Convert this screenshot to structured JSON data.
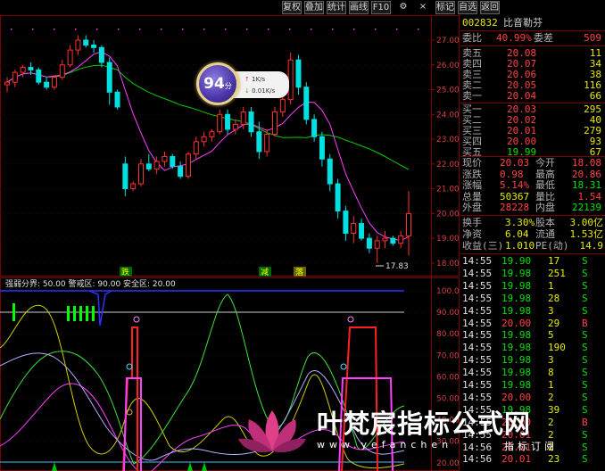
{
  "toolbar": {
    "buttons": [
      "复权",
      "叠加",
      "统计",
      "画线",
      "F10",
      "标记",
      "自选",
      "返回"
    ],
    "gear_icon": "gear-icon",
    "close_icon": "close-icon"
  },
  "stock": {
    "code": "002832",
    "name": "比音勒芬"
  },
  "order_book": {
    "weibi_label": "委比",
    "weibi_value": "40.99%",
    "weicha_label": "委差",
    "weicha_value": "509",
    "asks": [
      {
        "label": "卖五",
        "price": "20.08",
        "vol": "11"
      },
      {
        "label": "卖四",
        "price": "20.07",
        "vol": "34"
      },
      {
        "label": "卖三",
        "price": "20.06",
        "vol": "38"
      },
      {
        "label": "卖二",
        "price": "20.05",
        "vol": "116"
      },
      {
        "label": "卖一",
        "price": "20.04",
        "vol": "66"
      }
    ],
    "bids": [
      {
        "label": "买一",
        "price": "20.03",
        "vol": "295"
      },
      {
        "label": "买二",
        "price": "20.02",
        "vol": "40"
      },
      {
        "label": "买三",
        "price": "20.01",
        "vol": "279"
      },
      {
        "label": "买四",
        "price": "20.00",
        "vol": "93"
      },
      {
        "label": "买五",
        "price": "19.99",
        "vol": "67"
      }
    ]
  },
  "quote": [
    {
      "l1": "现价",
      "v1": "20.03",
      "l2": "今开",
      "v2": "18.08"
    },
    {
      "l1": "涨跌",
      "v1": "0.98",
      "l2": "最高",
      "v2": "20.86"
    },
    {
      "l1": "涨幅",
      "v1": "5.14%",
      "l2": "最低",
      "v2": "18.31"
    },
    {
      "l1": "总量",
      "v1": "50367",
      "l2": "量比",
      "v2": "1.54"
    },
    {
      "l1": "外盘",
      "v1": "28228",
      "l2": "内盘",
      "v2": "22139"
    }
  ],
  "finance": [
    {
      "l1": "换手",
      "v1": "3.30%",
      "l2": "股本",
      "v2": "3.00亿"
    },
    {
      "l1": "净资",
      "v1": "6.04",
      "l2": "流通",
      "v2": "1.53亿"
    },
    {
      "l1": "收益(三)",
      "v1": "1.010",
      "l2": "PE(动)",
      "v2": "14.9"
    }
  ],
  "ticks": [
    {
      "time": "14:55",
      "price": "19.90",
      "vol": "17",
      "side": "S"
    },
    {
      "time": "14:55",
      "price": "19.98",
      "vol": "251",
      "side": "S"
    },
    {
      "time": "14:55",
      "price": "19.98",
      "vol": "1",
      "side": "S"
    },
    {
      "time": "14:55",
      "price": "19.98",
      "vol": "28",
      "side": "S"
    },
    {
      "time": "14:55",
      "price": "19.98",
      "vol": "3",
      "side": "S"
    },
    {
      "time": "14:55",
      "price": "20.00",
      "vol": "29",
      "side": "B"
    },
    {
      "time": "14:55",
      "price": "19.98",
      "vol": "5",
      "side": "S"
    },
    {
      "time": "14:55",
      "price": "19.98",
      "vol": "190",
      "side": "S"
    },
    {
      "time": "14:55",
      "price": "19.98",
      "vol": "3",
      "side": "S"
    },
    {
      "time": "14:55",
      "price": "19.98",
      "vol": "8",
      "side": "S"
    },
    {
      "time": "14:55",
      "price": "19.98",
      "vol": "1",
      "side": "S"
    },
    {
      "time": "14:55",
      "price": "20.00",
      "vol": "2",
      "side": "S"
    },
    {
      "time": "14:55",
      "price": "19.98",
      "vol": "39",
      "side": "S"
    },
    {
      "time": "14:55",
      "price": "20.00",
      "vol": "2",
      "side": "B"
    },
    {
      "time": "14:55",
      "price": "20.01",
      "vol": "2",
      "side": "S"
    },
    {
      "time": "14:56",
      "price": "20.01",
      "vol": "2",
      "side": "S"
    },
    {
      "time": "14:56",
      "price": "20.01",
      "vol": "23",
      "side": "S"
    }
  ],
  "main_chart": {
    "y_ticks": [
      "27.00",
      "26.00",
      "25.00",
      "24.00",
      "23.00",
      "22.00",
      "21.00",
      "20.00",
      "19.00",
      "18.00"
    ],
    "low_marker": "17.83",
    "signals": [
      "跌",
      "减",
      "落"
    ]
  },
  "indicator": {
    "header": "强弱分界: 50.00  警戒区: 90.00  安全区: 20.00",
    "y_ticks": [
      "100.0",
      "90.00",
      "80.00",
      "70.00",
      "60.00",
      "50.00",
      "40.00",
      "30.00",
      "20.00"
    ]
  },
  "score_badge": {
    "score": "94",
    "unit": "分",
    "up_speed": "1K/s",
    "down_speed": "0.01K/s"
  },
  "watermark": {
    "title": "叶梵宸指标公式网",
    "url": "www.yefanchen",
    "sub": "指标订阅"
  },
  "colors": {
    "up": "#ff3030",
    "down": "#00e0e0",
    "ma_fast": "#ff40ff",
    "ma_slow": "#00d000"
  },
  "chart_data": {
    "type": "candlestick",
    "ylim": [
      17.6,
      27.9
    ],
    "ohlc": [
      [
        25.2,
        25.5,
        24.9,
        25.3
      ],
      [
        25.3,
        25.8,
        25.1,
        25.7
      ],
      [
        25.7,
        26.0,
        25.5,
        25.9
      ],
      [
        25.9,
        26.1,
        25.6,
        25.8
      ],
      [
        25.8,
        25.9,
        25.2,
        25.3
      ],
      [
        25.3,
        25.5,
        25.0,
        25.1
      ],
      [
        25.1,
        25.6,
        25.0,
        25.5
      ],
      [
        25.5,
        26.2,
        25.4,
        26.0
      ],
      [
        26.0,
        26.8,
        25.9,
        26.6
      ],
      [
        26.6,
        27.2,
        26.4,
        27.0
      ],
      [
        27.0,
        27.2,
        26.7,
        26.8
      ],
      [
        26.8,
        27.0,
        26.5,
        26.7
      ],
      [
        26.7,
        26.8,
        25.9,
        26.1
      ],
      [
        26.1,
        26.3,
        24.4,
        24.9
      ],
      [
        24.9,
        25.0,
        24.2,
        24.3
      ],
      [
        22.0,
        22.3,
        20.7,
        21.0
      ],
      [
        21.0,
        21.3,
        20.9,
        21.2
      ],
      [
        21.2,
        22.2,
        21.1,
        22.0
      ],
      [
        22.0,
        22.4,
        21.7,
        21.8
      ],
      [
        21.8,
        22.3,
        21.6,
        22.1
      ],
      [
        22.1,
        22.5,
        21.9,
        22.3
      ],
      [
        22.3,
        22.4,
        21.8,
        21.9
      ],
      [
        21.9,
        22.1,
        21.4,
        21.5
      ],
      [
        21.5,
        22.5,
        21.4,
        22.4
      ],
      [
        22.4,
        23.1,
        22.2,
        22.9
      ],
      [
        22.9,
        23.3,
        22.7,
        23.1
      ],
      [
        23.1,
        23.4,
        22.9,
        23.3
      ],
      [
        23.3,
        24.2,
        23.2,
        24.0
      ],
      [
        24.0,
        24.2,
        23.2,
        23.4
      ],
      [
        23.4,
        23.8,
        23.2,
        23.6
      ],
      [
        23.6,
        24.3,
        23.4,
        24.1
      ],
      [
        24.1,
        24.3,
        23.1,
        23.3
      ],
      [
        23.3,
        23.7,
        22.2,
        22.5
      ],
      [
        22.5,
        23.4,
        22.3,
        23.2
      ],
      [
        23.2,
        24.3,
        23.1,
        24.1
      ],
      [
        24.1,
        24.8,
        23.9,
        24.6
      ],
      [
        24.6,
        26.5,
        24.4,
        26.2
      ],
      [
        26.2,
        26.4,
        24.8,
        25.1
      ],
      [
        25.1,
        25.3,
        23.6,
        23.8
      ],
      [
        23.8,
        24.0,
        22.9,
        23.1
      ],
      [
        23.1,
        23.3,
        21.9,
        22.2
      ],
      [
        22.2,
        22.4,
        20.9,
        21.2
      ],
      [
        21.2,
        21.4,
        19.8,
        20.1
      ],
      [
        20.1,
        20.3,
        18.9,
        19.2
      ],
      [
        19.2,
        19.9,
        18.8,
        19.6
      ],
      [
        19.6,
        19.8,
        18.9,
        19.0
      ],
      [
        19.0,
        19.2,
        18.4,
        18.6
      ],
      [
        18.6,
        19.1,
        18.0,
        18.9
      ],
      [
        18.9,
        19.3,
        18.6,
        19.0
      ],
      [
        19.0,
        19.1,
        18.7,
        18.8
      ],
      [
        18.8,
        19.3,
        18.6,
        19.1
      ],
      [
        19.1,
        20.9,
        18.3,
        20.0
      ]
    ]
  }
}
